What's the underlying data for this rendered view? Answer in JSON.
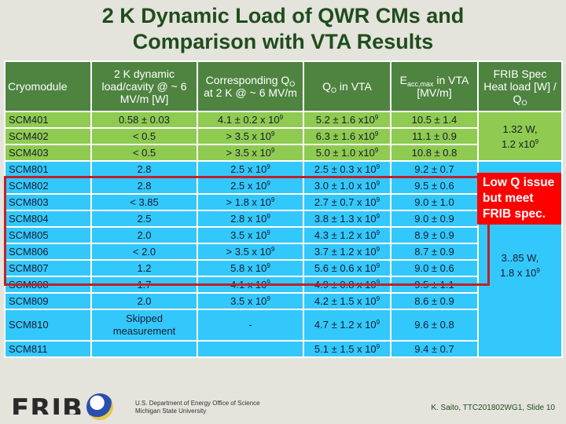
{
  "title": {
    "line1": "2 K Dynamic Load of QWR CMs and",
    "line2": "Comparison with VTA Results"
  },
  "table": {
    "headers": {
      "cryomodule": "Cryomodule",
      "load": "2 K dynamic load/cavity @ ~ 6 MV/m [W]",
      "q0_2k_pre": "Corresponding Q",
      "q0_2k_sub": "O",
      "q0_2k_post": " at 2 K @ ~ 6 MV/m",
      "q0_vta_pre": "Q",
      "q0_vta_sub": "O",
      "q0_vta_post": " in VTA",
      "eacc_pre": "E",
      "eacc_sub": "acc,max",
      "eacc_post": " in VTA [MV/m]",
      "spec_pre": "FRIB Spec Heat load [W] / Q",
      "spec_sub": "O"
    },
    "rows": [
      {
        "cm": "SCM401",
        "load": "0.58 ± 0.03",
        "q0_2k": "4.1 ± 0.2 x 10",
        "q0_vta": "5.2 ± 1.6  x10",
        "eacc": "10.5 ± 1.4"
      },
      {
        "cm": "SCM402",
        "load": "< 0.5",
        "q0_2k": "> 3.5 x 10",
        "q0_vta": "6.3 ± 1.6  x10",
        "eacc": "11.1 ± 0.9"
      },
      {
        "cm": "SCM403",
        "load": "< 0.5",
        "q0_2k": "> 3.5 x 10",
        "q0_vta": "5.0 ± 1.0  x10",
        "eacc": "10.8 ± 0.8"
      },
      {
        "cm": "SCM801",
        "load": "2.8",
        "q0_2k": "2.5 x 10",
        "q0_vta": "2.5 ± 0.3 x 10",
        "eacc": "9.2 ± 0.7"
      },
      {
        "cm": "SCM802",
        "load": "2.8",
        "q0_2k": "2.5 x 10",
        "q0_vta": "3.0 ± 1.0 x 10",
        "eacc": "9.5 ± 0.6"
      },
      {
        "cm": "SCM803",
        "load": "< 3.85",
        "q0_2k": "> 1.8 x 10",
        "q0_vta": "2.7 ± 0.7 x 10",
        "eacc": "9.0 ± 1.0"
      },
      {
        "cm": "SCM804",
        "load": "2.5",
        "q0_2k": "2.8 x 10",
        "q0_vta": "3.8 ± 1.3 x 10",
        "eacc": "9.0 ± 0.9"
      },
      {
        "cm": "SCM805",
        "load": "2.0",
        "q0_2k": "3.5 x 10",
        "q0_vta": "4.3 ± 1.2 x 10",
        "eacc": "8.9 ± 0.9"
      },
      {
        "cm": "SCM806",
        "load": "< 2.0",
        "q0_2k": "> 3.5 x 10",
        "q0_vta": "3.7 ± 1.2 x 10",
        "eacc": "8.7 ± 0.9"
      },
      {
        "cm": "SCM807",
        "load": "1.2",
        "q0_2k": "5.8 x 10",
        "q0_vta": "5.6 ± 0.6 x 10",
        "eacc": "9.0 ± 0.6"
      },
      {
        "cm": "SCM808",
        "load": "1.7",
        "q0_2k": "4.1 x 10",
        "q0_vta": "4.9 ± 0.8 x 10",
        "eacc": "9.5 ± 1.1"
      },
      {
        "cm": "SCM809",
        "load": "2.0",
        "q0_2k": "3.5 x 10",
        "q0_vta": "4.2 ± 1.5 x 10",
        "eacc": "8.6 ± 0.9"
      },
      {
        "cm": "SCM810",
        "load": "Skipped measurement",
        "q0_2k": "-",
        "q0_vta": "4.7 ± 1.2 x 10",
        "eacc": "9.6 ± 0.8"
      },
      {
        "cm": "SCM811",
        "load": "",
        "q0_2k": "",
        "q0_vta": "5.1 ± 1.5 x 10",
        "eacc": "9.4 ± 0.7"
      }
    ],
    "exponent": "9",
    "spec_401": {
      "line1": "1.32 W,",
      "line2": "1.2 x10"
    },
    "spec_801": {
      "line1": "3..85 W,",
      "line2": "1.8 x 10"
    }
  },
  "callout": {
    "text": "Low Q issue but meet FRIB spec.",
    "color": "#ff0000"
  },
  "highlight": {
    "rows": [
      "SCM801",
      "SCM802",
      "SCM803",
      "SCM804",
      "SCM805",
      "SCM806"
    ],
    "color": "#c0202a"
  },
  "colors": {
    "header": "#4e8440",
    "scm400_rows": "#8ecb50",
    "scm800_rows": "#33c8fb",
    "title": "#1f4d1c"
  },
  "footer": {
    "logo": "FRIB",
    "org_line1": "U.S. Department of Energy Office of Science",
    "org_line2": "Michigan State University",
    "credit": "K. Saito, TTC201802WG1, Slide 10"
  }
}
